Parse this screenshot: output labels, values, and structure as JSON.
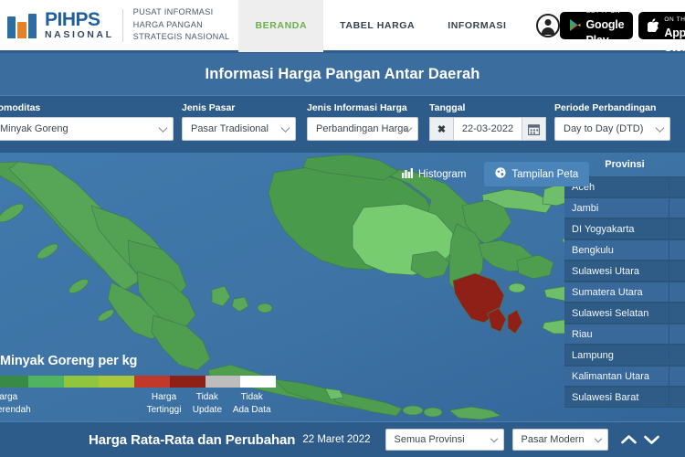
{
  "header": {
    "logo_title": "PIHPS",
    "logo_sub": "NASIONAL",
    "tagline_line1": "PUSAT INFORMASI",
    "tagline_line2": "HARGA PANGAN",
    "tagline_line3": "STRATEGIS NASIONAL",
    "nav": [
      {
        "label": "BERANDA",
        "active": true
      },
      {
        "label": "TABEL HARGA",
        "active": false
      },
      {
        "label": "INFORMASI",
        "active": false
      }
    ],
    "account_icon": "person-icon",
    "badges": [
      {
        "icon": "google-play-icon",
        "line1": "GET IT ON",
        "line2": "Google Play"
      },
      {
        "icon": "apple-icon",
        "line1": "Download on the",
        "line2": "App Store"
      }
    ]
  },
  "page_title": "Informasi Harga Pangan Antar Daerah",
  "filters": {
    "komoditas": {
      "label": "Komoditas",
      "value": "Minyak Goreng"
    },
    "jenis_pasar": {
      "label": "Jenis Pasar",
      "value": "Pasar Tradisional"
    },
    "jenis_informasi": {
      "label": "Jenis Informasi Harga",
      "value": "Perbandingan Harga"
    },
    "tanggal": {
      "label": "Tanggal",
      "value": "22-03-2022",
      "clear_icon": "clear-x-icon",
      "calendar_icon": "calendar-icon"
    },
    "periode": {
      "label": "Periode Perbandingan",
      "value": "Day to Day (DTD)"
    }
  },
  "map_controls": {
    "histogram": {
      "label": "Histogram",
      "icon": "bar-chart-icon",
      "active": false
    },
    "tampilan_peta": {
      "label": "Tampilan Peta",
      "icon": "globe-icon",
      "active": true
    }
  },
  "province_panel": {
    "header": "Provinsi",
    "items": [
      "Aceh",
      "Jambi",
      "DI Yogyakarta",
      "Bengkulu",
      "Sulawesi Utara",
      "Sumatera Utara",
      "Sulawesi Selatan",
      "Riau",
      "Lampung",
      "Kalimantan Utara",
      "Sulawesi Barat"
    ]
  },
  "legend": {
    "title": "Minyak Goreng per kg",
    "colors": [
      "#3a8a47",
      "#4fb35f",
      "#8fc63d",
      "#afc83a",
      "#c0392b",
      "#8e2018",
      "#bdbdbd",
      "#ffffff"
    ],
    "label_low": "Harga\nTerendah",
    "label_low_l1": "Harga",
    "label_low_l2": "Terendah",
    "label_high_l1": "Harga",
    "label_high_l2": "Tertinggi",
    "label_noupdate_l1": "Tidak",
    "label_noupdate_l2": "Update",
    "label_nodata_l1": "Tidak",
    "label_nodata_l2": "Ada Data"
  },
  "bottom": {
    "title": "Harga Rata-Rata dan Perubahan",
    "date": "22 Maret 2022",
    "province_select": "Semua Provinsi",
    "market_select": "Pasar Modern",
    "scroll_up_icon": "chevron-up-icon",
    "scroll_down_icon": "chevron-down-icon"
  },
  "colors": {
    "brand_blue": "#1f5f9c",
    "brand_orange": "#e98124",
    "nav_active": "#6ab04c",
    "panel_blue": "#2e5c8a",
    "title_blue": "#3b6d9e",
    "ocean": "#3d72a4",
    "land_green": "#4f9e50",
    "land_light_green": "#76cc6e",
    "highlight_red": "#8e2018"
  }
}
